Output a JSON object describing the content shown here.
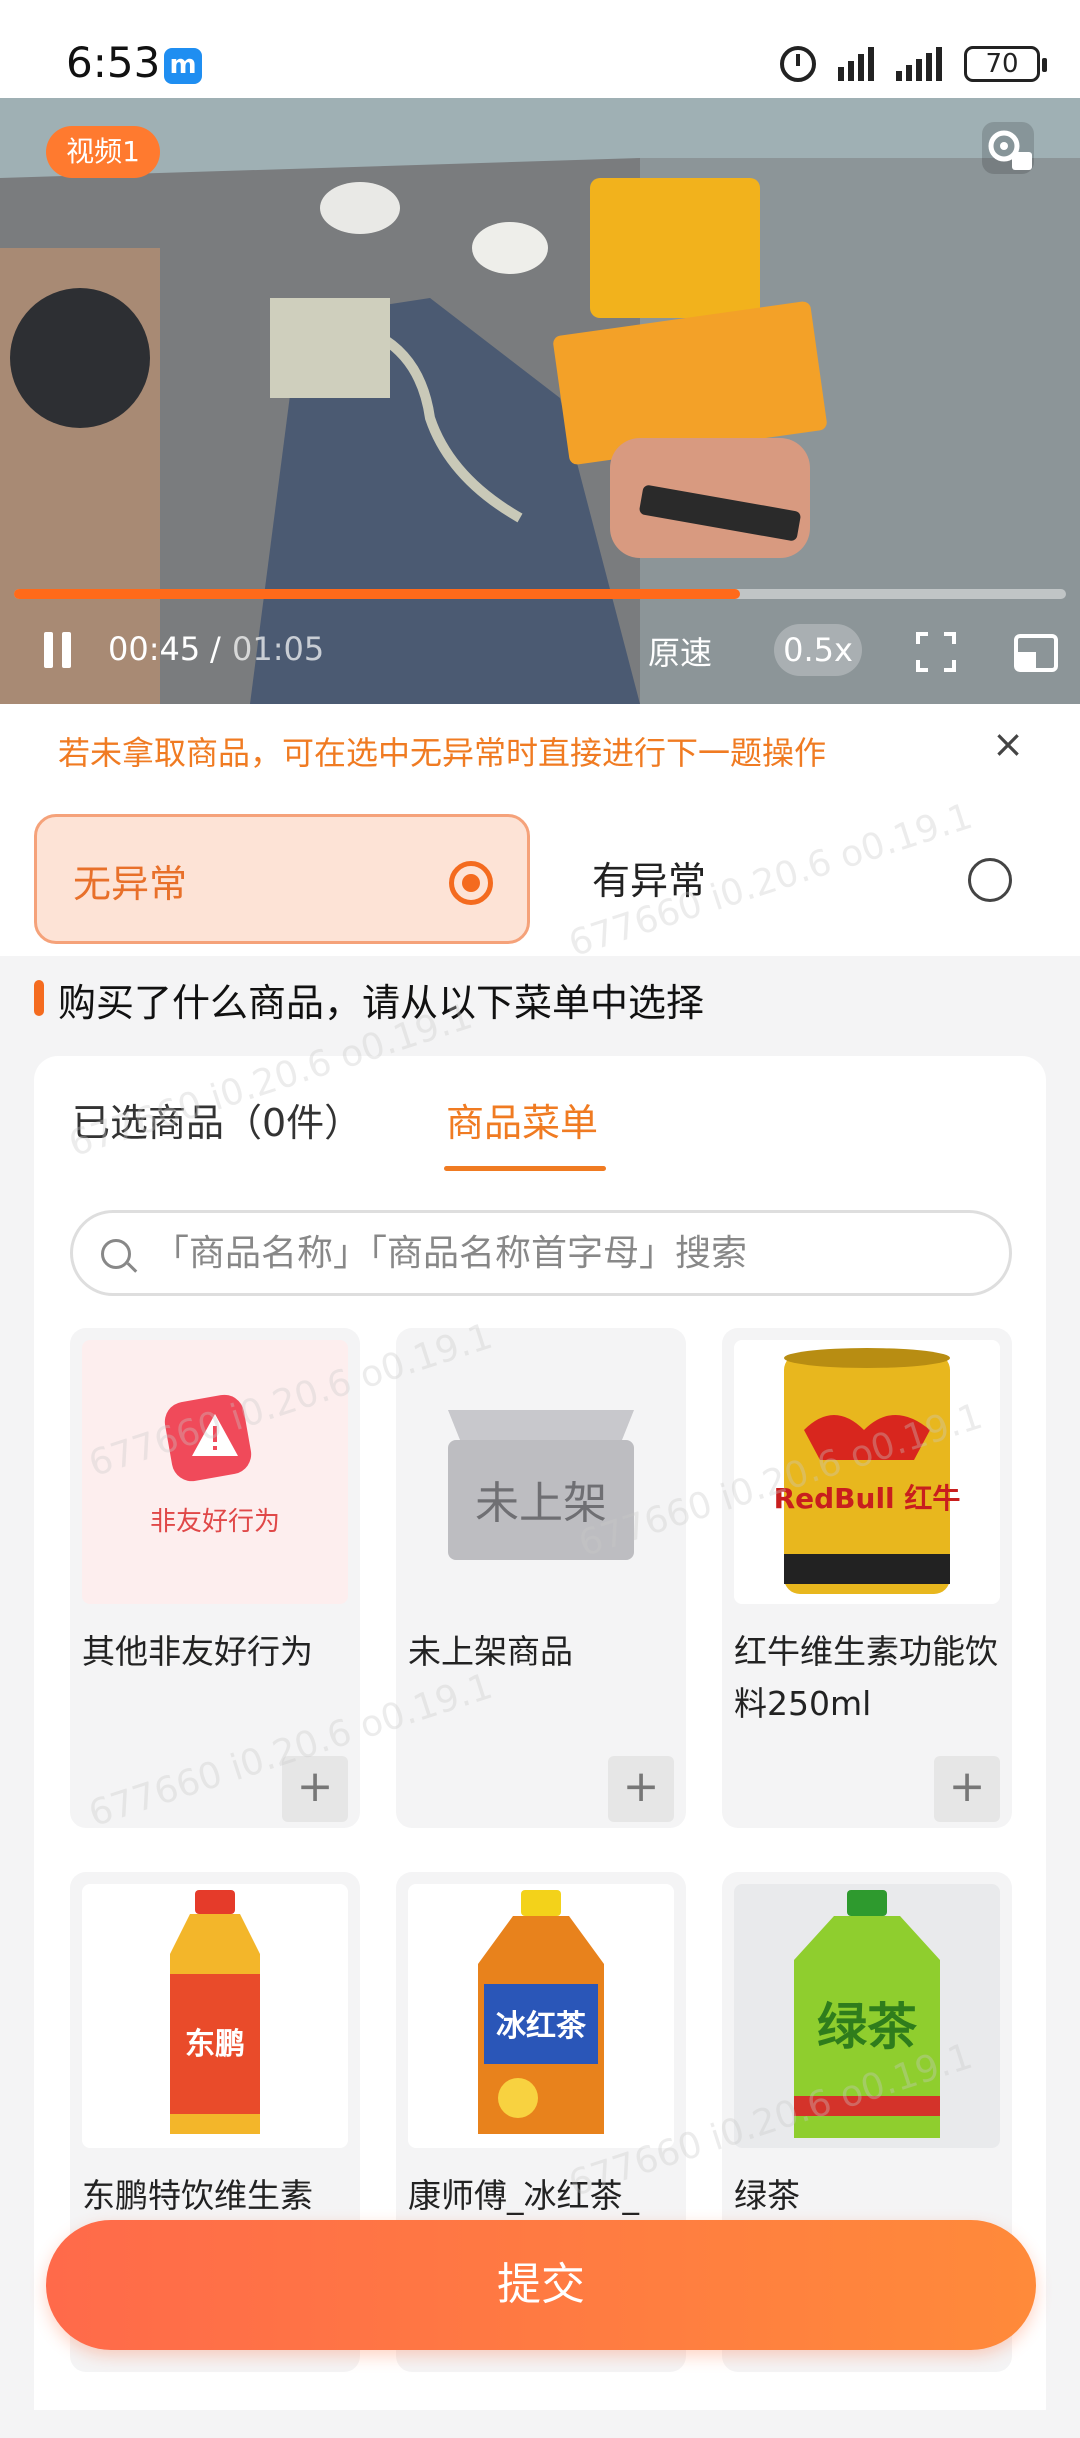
{
  "status_bar": {
    "time": "6:53",
    "app_icon_letter": "m",
    "battery": "70"
  },
  "video": {
    "tag": "视频1",
    "current_time": "00:45",
    "separator": "/",
    "total_time": "01:05",
    "progress": 0.69,
    "speed_label": "原速",
    "speed_value": "0.5x"
  },
  "notice": {
    "text": "若未拿取商品，可在选中无异常时直接进行下一题操作",
    "close": "×"
  },
  "options": {
    "normal": "无异常",
    "abnormal": "有异常",
    "selected": "normal"
  },
  "question": "购买了什么商品，请从以下菜单中选择",
  "tabs": {
    "selected_products": "已选商品（0件）",
    "menu": "商品菜单"
  },
  "search": {
    "placeholder": "「商品名称」「商品名称首字母」搜索"
  },
  "products": [
    {
      "name": "其他非友好行为",
      "image_text": "非友好行为",
      "icon": "warning-icon"
    },
    {
      "name": "未上架商品",
      "image_text": "未上架",
      "icon": "box-icon"
    },
    {
      "name": "红牛维生素功能饮料250ml",
      "image_text": "RedBull 红牛",
      "icon": "can-icon"
    },
    {
      "name": "东鹏特饮维生素",
      "image_text": "东鹏",
      "icon": "bottle-icon"
    },
    {
      "name": "康师傅_冰红茶_",
      "image_text": "冰红茶",
      "icon": "bottle-icon"
    },
    {
      "name": "绿茶",
      "image_text": "绿茶",
      "icon": "bottle-icon"
    }
  ],
  "add_label": "+",
  "submit_label": "提交",
  "watermark": "677660 i0.20.6 o0.19.1",
  "colors": {
    "accent": "#f46b1f",
    "accent_light": "#fde3d6",
    "notice_text": "#f07b22",
    "submit_start": "#ff6a4a",
    "submit_end": "#ff8a3a"
  }
}
